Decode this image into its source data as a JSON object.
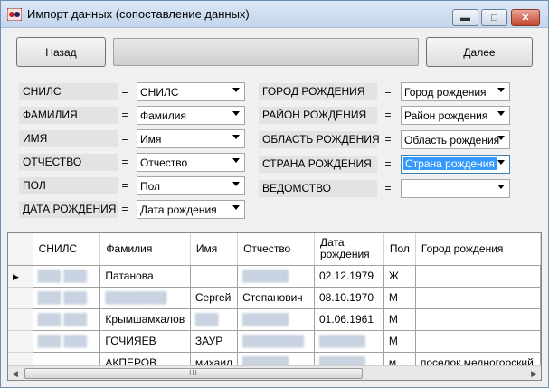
{
  "window": {
    "title": "Импорт данных (сопоставление данных)",
    "minimize": "▬",
    "maximize": "□",
    "close": "✕"
  },
  "toolbar": {
    "back_label": "Назад",
    "next_label": "Далее"
  },
  "mapping_left": [
    {
      "field": "СНИЛС",
      "eq": "=",
      "value": "СНИЛС"
    },
    {
      "field": "ФАМИЛИЯ",
      "eq": "=",
      "value": "Фамилия"
    },
    {
      "field": "ИМЯ",
      "eq": "=",
      "value": "Имя"
    },
    {
      "field": "ОТЧЕСТВО",
      "eq": "=",
      "value": "Отчество"
    },
    {
      "field": "ПОЛ",
      "eq": "=",
      "value": "Пол"
    },
    {
      "field": "ДАТА РОЖДЕНИЯ",
      "eq": "=",
      "value": "Дата рождения"
    }
  ],
  "mapping_right": [
    {
      "field": "ГОРОД РОЖДЕНИЯ",
      "eq": "=",
      "value": "Город рождения"
    },
    {
      "field": "РАЙОН РОЖДЕНИЯ",
      "eq": "=",
      "value": "Район рождения"
    },
    {
      "field": "ОБЛАСТЬ РОЖДЕНИЯ",
      "eq": "=",
      "value": "Область рождения"
    },
    {
      "field": "СТРАНА РОЖДЕНИЯ",
      "eq": "=",
      "value": "Страна рождения"
    },
    {
      "field": "ВЕДОМСТВО",
      "eq": "=",
      "value": ""
    }
  ],
  "grid": {
    "columns": [
      "СНИЛС",
      "Фамилия",
      "Имя",
      "Отчество",
      "Дата рождения",
      "Пол",
      "Город рождения"
    ],
    "rows": [
      [
        "",
        "Патанова",
        "",
        "",
        "02.12.1979",
        "Ж",
        ""
      ],
      [
        "",
        "",
        "Сергей",
        "Степанович",
        "08.10.1970",
        "М",
        ""
      ],
      [
        "",
        "Крымшамхалов",
        "",
        "",
        "01.06.1961",
        "М",
        ""
      ],
      [
        "",
        "ГОЧИЯЕВ",
        "ЗАУР",
        "",
        "",
        "М",
        ""
      ],
      [
        "",
        "АКПЕРОВ",
        "михаил",
        "",
        "",
        "м",
        "поселок медногорский"
      ]
    ],
    "current_row_marker": "▶"
  },
  "scrollbar": {
    "left_arrow": "◀",
    "right_arrow": "▶",
    "grip": "III"
  }
}
